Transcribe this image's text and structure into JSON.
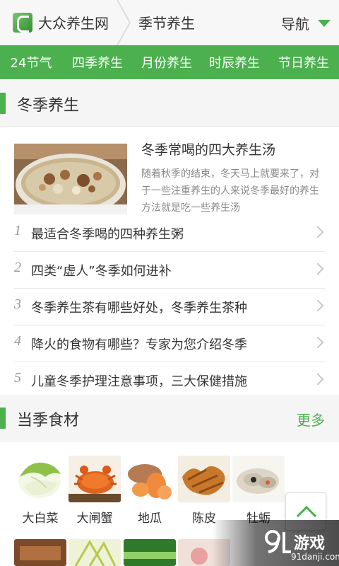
{
  "header": {
    "site_name": "大众养生网",
    "section": "季节养生",
    "nav_label": "导航"
  },
  "categories": [
    "24节气",
    "四季养生",
    "月份养生",
    "时辰养生",
    "节日养生"
  ],
  "winter": {
    "title": "冬季养生",
    "featured": {
      "title": "冬季常喝的四大养生汤",
      "desc": "随着秋季的结束，冬天马上就要来了，对于一些注重养生的人来说冬季最好的养生方法就是吃一些养生汤",
      "image": "soup-bowl-image"
    },
    "items": [
      {
        "num": "1",
        "text": "最适合冬季喝的四种养生粥"
      },
      {
        "num": "2",
        "text": "四类“虚人”冬季如何进补"
      },
      {
        "num": "3",
        "text": "冬季养生茶有哪些好处，冬季养生茶种"
      },
      {
        "num": "4",
        "text": "降火的食物有哪些？专家为您介绍冬季"
      },
      {
        "num": "5",
        "text": "儿童冬季护理注意事项，三大保健措施"
      }
    ]
  },
  "ingredients": {
    "title": "当季食材",
    "more": "更多",
    "items": [
      {
        "label": "大白菜",
        "image": "chinese-cabbage-image"
      },
      {
        "label": "大闸蟹",
        "image": "hairy-crab-image"
      },
      {
        "label": "地瓜",
        "image": "sweet-potato-image"
      },
      {
        "label": "陈皮",
        "image": "dried-tangerine-peel-image"
      },
      {
        "label": "牡蛎",
        "image": "oyster-image"
      }
    ]
  },
  "watermark": {
    "brand": "游戏",
    "domain": "91danji.com"
  },
  "colors": {
    "accent": "#4cb04f",
    "header_bg": "#f7f7f7",
    "muted_text": "#888888"
  }
}
